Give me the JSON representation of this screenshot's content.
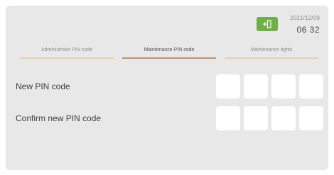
{
  "status": {
    "date": "2021/12/09",
    "time": "06 32"
  },
  "tabs": [
    {
      "label": "Administrator PIN code",
      "active": false
    },
    {
      "label": "Maintenance PIN code",
      "active": true
    },
    {
      "label": "Maintenance rights",
      "active": false
    }
  ],
  "fields": {
    "new_pin_label": "New PIN code",
    "confirm_pin_label": "Confirm new PIN code"
  },
  "icons": {
    "exit": "exit-door-icon"
  },
  "colors": {
    "accent_green": "#6fae4a",
    "active_tab_underline": "#c09468",
    "inactive_tab_underline": "#e6cfb4",
    "panel_background": "#e8e8e8"
  }
}
